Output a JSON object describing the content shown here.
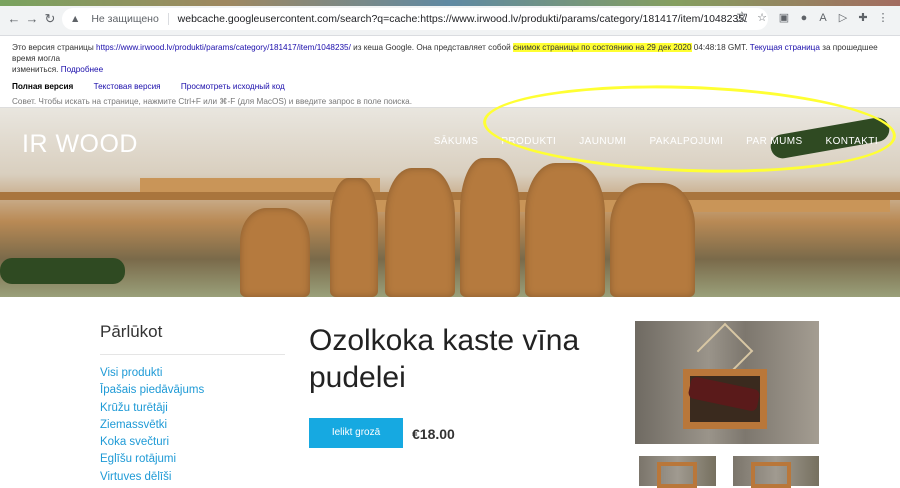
{
  "browser": {
    "insecure_label": "Не защищено",
    "url": "webcache.googleusercontent.com/search?q=cache:https://www.irwood.lv/produkti/params/category/181417/item/1048235/",
    "colors": {
      "highlight": "#ffff33",
      "accent": "#16a9e1"
    }
  },
  "cache": {
    "line1_pre": "Это версия страницы ",
    "line1_link": "https://www.irwood.lv/produkti/params/category/181417/item/1048235/",
    "line1_mid": " из кеша Google. Она представляет собой ",
    "line1_hl": "снимок страницы по состоянию на 29 дек 2020",
    "line1_time": " 04:48:18 GMT. ",
    "line1_link2": "Текущая страница",
    "line1_post": " за прошедшее время могла",
    "line2": "измениться. ",
    "line2_link": "Подробнее",
    "full_version": "Полная версия",
    "text_version": "Текстовая версия",
    "view_source": "Просмотреть исходный код",
    "hint": "Совет. Чтобы искать на странице, нажмите Ctrl+F или ⌘-F (для MacOS) и введите запрос в поле поиска."
  },
  "site": {
    "logo": "IR WOOD",
    "menu": [
      "SĀKUMS",
      "PRODUKTI",
      "JAUNUMI",
      "PAKALPOJUMI",
      "PAR MUMS",
      "KONTAKTI"
    ]
  },
  "sidebar": {
    "title": "Pārlūkot",
    "items": [
      "Visi produkti",
      "Īpašais piedāvājums",
      "Krūžu turētāji",
      "Ziemassvētki",
      "Koka svečturi",
      "Eglīšu rotājumi",
      "Virtuves dēlīši"
    ]
  },
  "product": {
    "title": "Ozolkoka kaste vīna pudelei",
    "add_to_cart": "Ielikt grozā",
    "price": "€18.00"
  }
}
